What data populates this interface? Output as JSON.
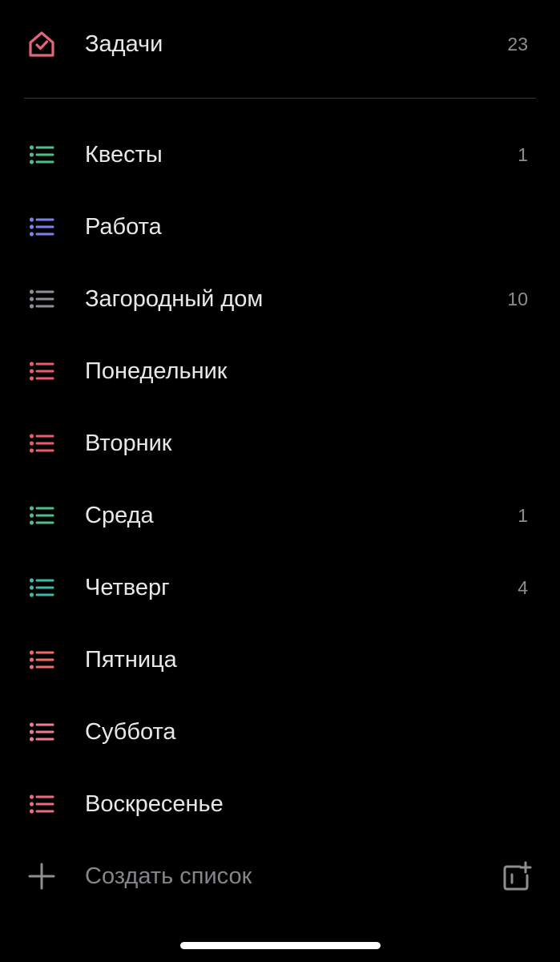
{
  "tasks": {
    "label": "Задачи",
    "count": "23",
    "icon": "home-check-icon",
    "color": "#e0667a"
  },
  "lists": [
    {
      "label": "Квесты",
      "count": "1",
      "color": "#4fbf8a",
      "icon": "list-icon"
    },
    {
      "label": "Работа",
      "count": "",
      "color": "#7b7ff0",
      "icon": "list-icon"
    },
    {
      "label": "Загородный дом",
      "count": "10",
      "color": "#8e8e96",
      "icon": "list-icon"
    },
    {
      "label": "Понедельник",
      "count": "",
      "color": "#ee5a6a",
      "icon": "list-icon"
    },
    {
      "label": "Вторник",
      "count": "",
      "color": "#ee5a6a",
      "icon": "list-icon"
    },
    {
      "label": "Среда",
      "count": "1",
      "color": "#4fbf8a",
      "icon": "list-icon"
    },
    {
      "label": "Четверг",
      "count": "4",
      "color": "#3fb8a8",
      "icon": "list-icon"
    },
    {
      "label": "Пятница",
      "count": "",
      "color": "#f06a6a",
      "icon": "list-icon"
    },
    {
      "label": "Суббота",
      "count": "",
      "color": "#f07a94",
      "icon": "list-icon"
    },
    {
      "label": "Воскресенье",
      "count": "",
      "color": "#ee6a80",
      "icon": "list-icon"
    }
  ],
  "create": {
    "label": "Создать список",
    "icon": "plus-icon",
    "group_icon": "new-group-icon"
  }
}
